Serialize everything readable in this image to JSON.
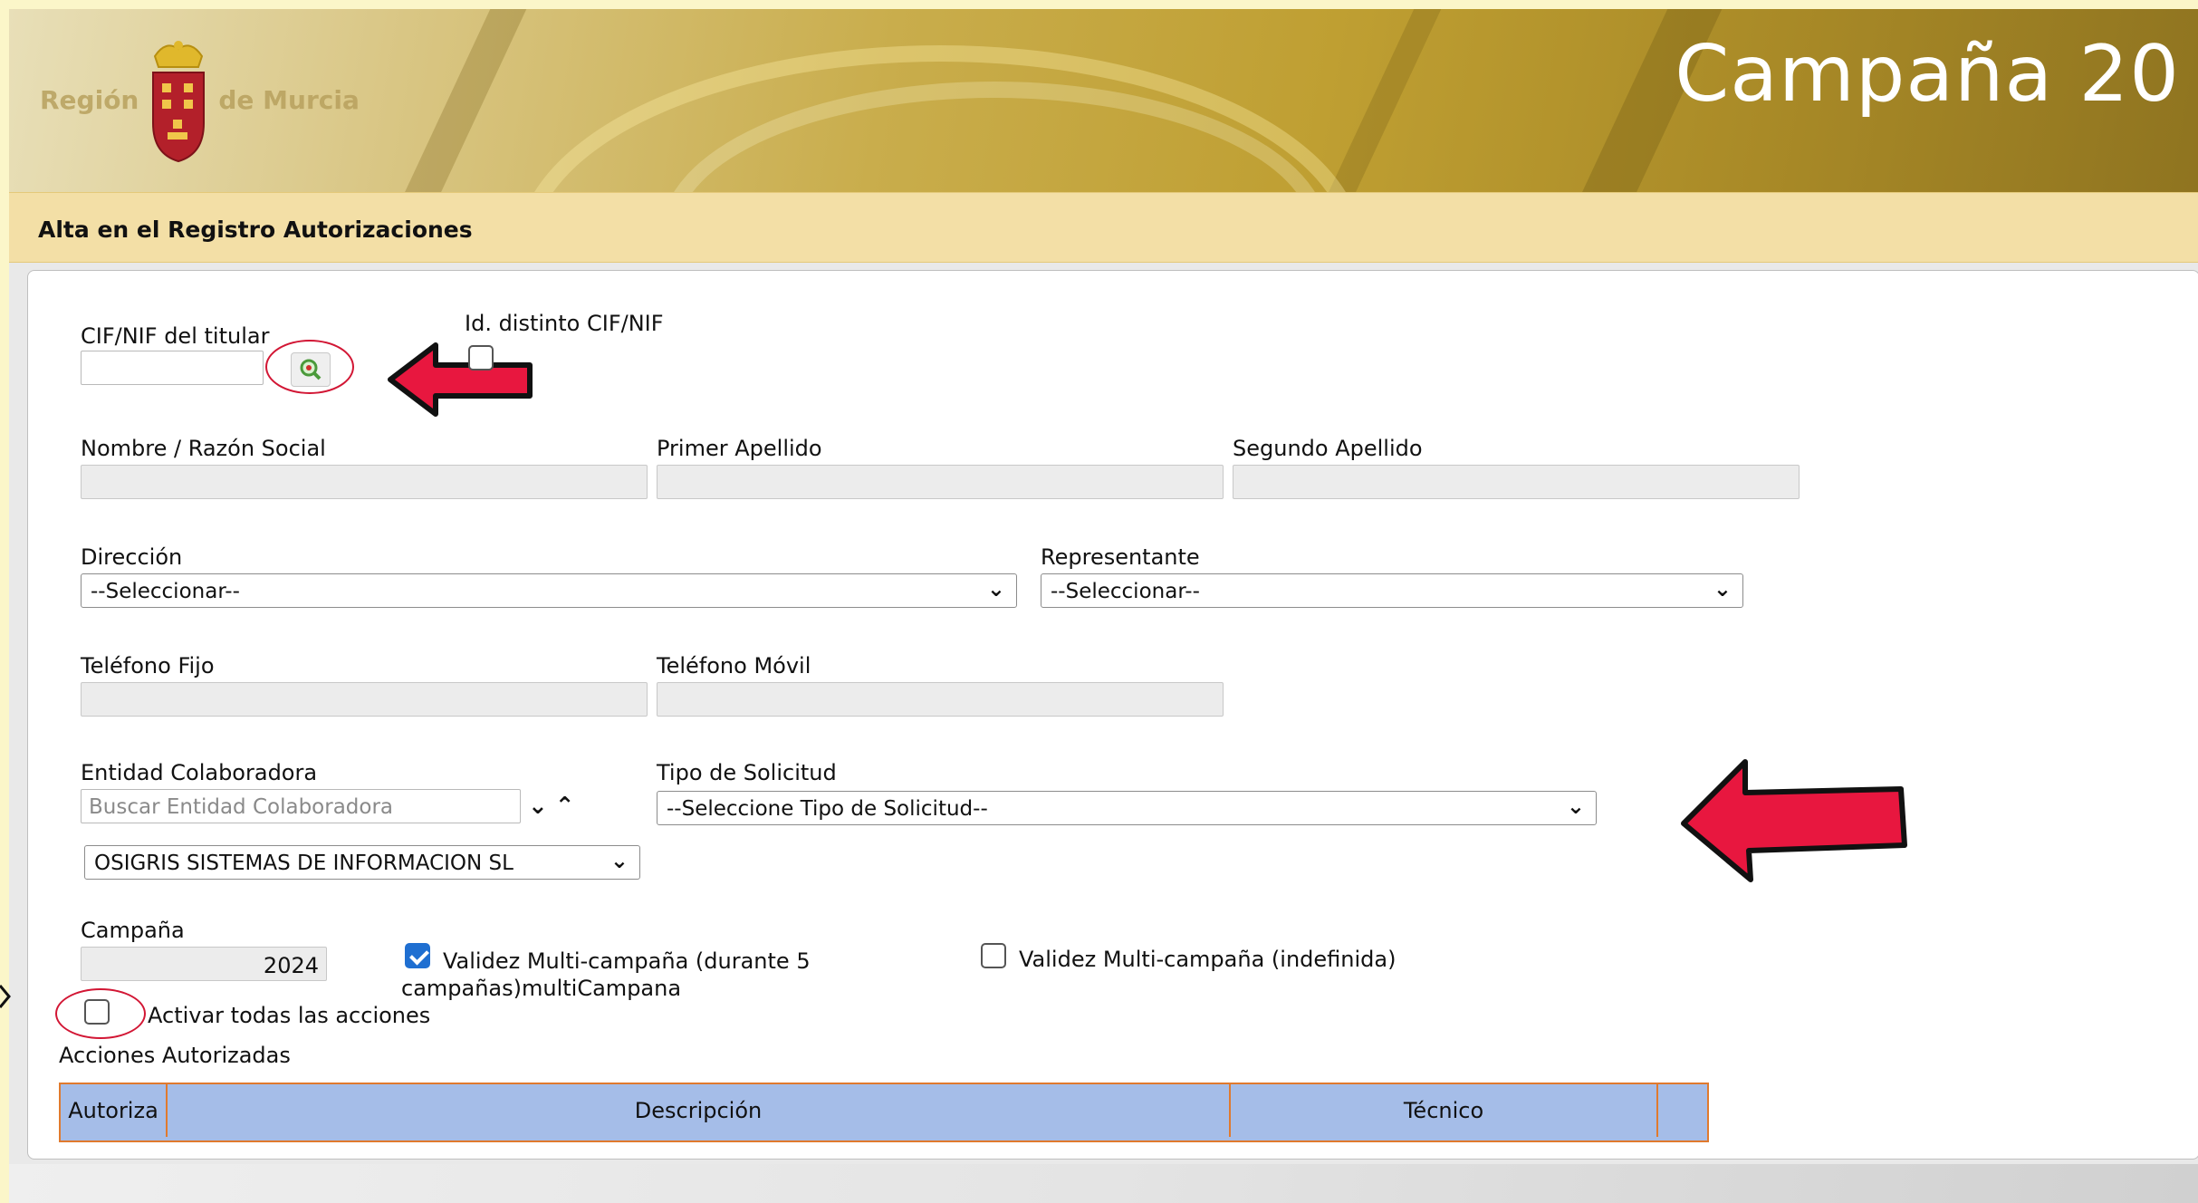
{
  "banner": {
    "logo_left": "Región",
    "logo_right": "de Murcia",
    "title": "Campaña 20"
  },
  "section": {
    "title": "Alta en el Registro Autorizaciones"
  },
  "form": {
    "cif_label": "CIF/NIF del titular",
    "cif_value": "",
    "id_distinto_label": "Id. distinto CIF/NIF",
    "nombre_label": "Nombre / Razón Social",
    "primer_apellido_label": "Primer Apellido",
    "segundo_apellido_label": "Segundo Apellido",
    "direccion_label": "Dirección",
    "direccion_value": "--Seleccionar--",
    "representante_label": "Representante",
    "representante_value": "--Seleccionar--",
    "telefono_fijo_label": "Teléfono Fijo",
    "telefono_movil_label": "Teléfono Móvil",
    "entidad_label": "Entidad Colaboradora",
    "entidad_search_placeholder": "Buscar Entidad Colaboradora",
    "entidad_value": "OSIGRIS SISTEMAS DE INFORMACION SL",
    "tipo_solicitud_label": "Tipo de Solicitud",
    "tipo_solicitud_value": "--Seleccione Tipo de Solicitud--",
    "campana_label": "Campaña",
    "campana_value": "2024",
    "multi5_label_line1": "Validez Multi-campaña (durante 5",
    "multi5_label_line2": "campañas)multiCampana",
    "multi5_checked": true,
    "multi_indef_label": "Validez Multi-campaña (indefinida)",
    "multi_indef_checked": false,
    "activar_todas_label": "Activar todas las acciones",
    "activar_todas_checked": false,
    "acciones_label": "Acciones Autorizadas"
  },
  "table": {
    "headers": [
      "Autoriza",
      "Descripción",
      "Técnico"
    ]
  },
  "colors": {
    "annotation_red": "#d21634",
    "table_header_bg": "#a5bde8",
    "table_border": "#e07a2e",
    "section_bg": "#f3dfa6",
    "checkbox_blue": "#1f6fd1"
  }
}
